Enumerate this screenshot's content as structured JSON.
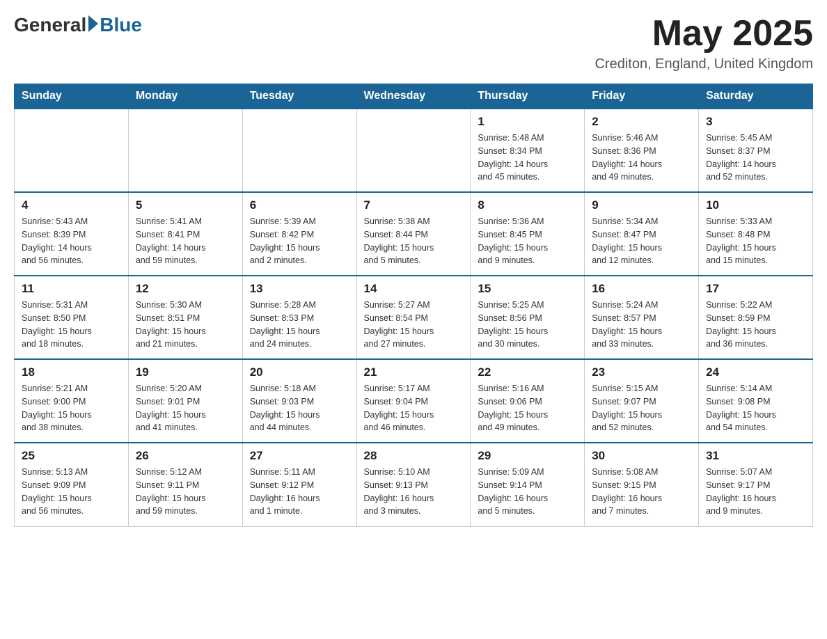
{
  "header": {
    "logo_general": "General",
    "logo_blue": "Blue",
    "month_title": "May 2025",
    "location": "Crediton, England, United Kingdom"
  },
  "days_of_week": [
    "Sunday",
    "Monday",
    "Tuesday",
    "Wednesday",
    "Thursday",
    "Friday",
    "Saturday"
  ],
  "weeks": [
    [
      {
        "day": "",
        "info": ""
      },
      {
        "day": "",
        "info": ""
      },
      {
        "day": "",
        "info": ""
      },
      {
        "day": "",
        "info": ""
      },
      {
        "day": "1",
        "info": "Sunrise: 5:48 AM\nSunset: 8:34 PM\nDaylight: 14 hours\nand 45 minutes."
      },
      {
        "day": "2",
        "info": "Sunrise: 5:46 AM\nSunset: 8:36 PM\nDaylight: 14 hours\nand 49 minutes."
      },
      {
        "day": "3",
        "info": "Sunrise: 5:45 AM\nSunset: 8:37 PM\nDaylight: 14 hours\nand 52 minutes."
      }
    ],
    [
      {
        "day": "4",
        "info": "Sunrise: 5:43 AM\nSunset: 8:39 PM\nDaylight: 14 hours\nand 56 minutes."
      },
      {
        "day": "5",
        "info": "Sunrise: 5:41 AM\nSunset: 8:41 PM\nDaylight: 14 hours\nand 59 minutes."
      },
      {
        "day": "6",
        "info": "Sunrise: 5:39 AM\nSunset: 8:42 PM\nDaylight: 15 hours\nand 2 minutes."
      },
      {
        "day": "7",
        "info": "Sunrise: 5:38 AM\nSunset: 8:44 PM\nDaylight: 15 hours\nand 5 minutes."
      },
      {
        "day": "8",
        "info": "Sunrise: 5:36 AM\nSunset: 8:45 PM\nDaylight: 15 hours\nand 9 minutes."
      },
      {
        "day": "9",
        "info": "Sunrise: 5:34 AM\nSunset: 8:47 PM\nDaylight: 15 hours\nand 12 minutes."
      },
      {
        "day": "10",
        "info": "Sunrise: 5:33 AM\nSunset: 8:48 PM\nDaylight: 15 hours\nand 15 minutes."
      }
    ],
    [
      {
        "day": "11",
        "info": "Sunrise: 5:31 AM\nSunset: 8:50 PM\nDaylight: 15 hours\nand 18 minutes."
      },
      {
        "day": "12",
        "info": "Sunrise: 5:30 AM\nSunset: 8:51 PM\nDaylight: 15 hours\nand 21 minutes."
      },
      {
        "day": "13",
        "info": "Sunrise: 5:28 AM\nSunset: 8:53 PM\nDaylight: 15 hours\nand 24 minutes."
      },
      {
        "day": "14",
        "info": "Sunrise: 5:27 AM\nSunset: 8:54 PM\nDaylight: 15 hours\nand 27 minutes."
      },
      {
        "day": "15",
        "info": "Sunrise: 5:25 AM\nSunset: 8:56 PM\nDaylight: 15 hours\nand 30 minutes."
      },
      {
        "day": "16",
        "info": "Sunrise: 5:24 AM\nSunset: 8:57 PM\nDaylight: 15 hours\nand 33 minutes."
      },
      {
        "day": "17",
        "info": "Sunrise: 5:22 AM\nSunset: 8:59 PM\nDaylight: 15 hours\nand 36 minutes."
      }
    ],
    [
      {
        "day": "18",
        "info": "Sunrise: 5:21 AM\nSunset: 9:00 PM\nDaylight: 15 hours\nand 38 minutes."
      },
      {
        "day": "19",
        "info": "Sunrise: 5:20 AM\nSunset: 9:01 PM\nDaylight: 15 hours\nand 41 minutes."
      },
      {
        "day": "20",
        "info": "Sunrise: 5:18 AM\nSunset: 9:03 PM\nDaylight: 15 hours\nand 44 minutes."
      },
      {
        "day": "21",
        "info": "Sunrise: 5:17 AM\nSunset: 9:04 PM\nDaylight: 15 hours\nand 46 minutes."
      },
      {
        "day": "22",
        "info": "Sunrise: 5:16 AM\nSunset: 9:06 PM\nDaylight: 15 hours\nand 49 minutes."
      },
      {
        "day": "23",
        "info": "Sunrise: 5:15 AM\nSunset: 9:07 PM\nDaylight: 15 hours\nand 52 minutes."
      },
      {
        "day": "24",
        "info": "Sunrise: 5:14 AM\nSunset: 9:08 PM\nDaylight: 15 hours\nand 54 minutes."
      }
    ],
    [
      {
        "day": "25",
        "info": "Sunrise: 5:13 AM\nSunset: 9:09 PM\nDaylight: 15 hours\nand 56 minutes."
      },
      {
        "day": "26",
        "info": "Sunrise: 5:12 AM\nSunset: 9:11 PM\nDaylight: 15 hours\nand 59 minutes."
      },
      {
        "day": "27",
        "info": "Sunrise: 5:11 AM\nSunset: 9:12 PM\nDaylight: 16 hours\nand 1 minute."
      },
      {
        "day": "28",
        "info": "Sunrise: 5:10 AM\nSunset: 9:13 PM\nDaylight: 16 hours\nand 3 minutes."
      },
      {
        "day": "29",
        "info": "Sunrise: 5:09 AM\nSunset: 9:14 PM\nDaylight: 16 hours\nand 5 minutes."
      },
      {
        "day": "30",
        "info": "Sunrise: 5:08 AM\nSunset: 9:15 PM\nDaylight: 16 hours\nand 7 minutes."
      },
      {
        "day": "31",
        "info": "Sunrise: 5:07 AM\nSunset: 9:17 PM\nDaylight: 16 hours\nand 9 minutes."
      }
    ]
  ]
}
